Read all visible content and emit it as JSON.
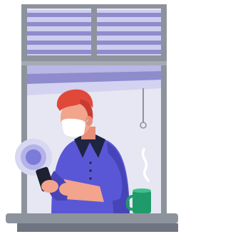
{
  "illustration": {
    "subject": "person-with-phone-at-window",
    "colors": {
      "frame": "#8d939c",
      "frame_dark": "#6f7580",
      "pane_bg": "#e6e7f2",
      "blind_light": "#c9c8ea",
      "blind_dark": "#8f8ccd",
      "shirt": "#5a57d6",
      "shirt_shadow": "#4744b8",
      "collar": "#1f2540",
      "hair": "#e0483a",
      "skin": "#f2a48c",
      "mask": "#ffffff",
      "phone": "#1e2130",
      "mug": "#1f9a6a",
      "wave": "#7d7bd8"
    }
  }
}
